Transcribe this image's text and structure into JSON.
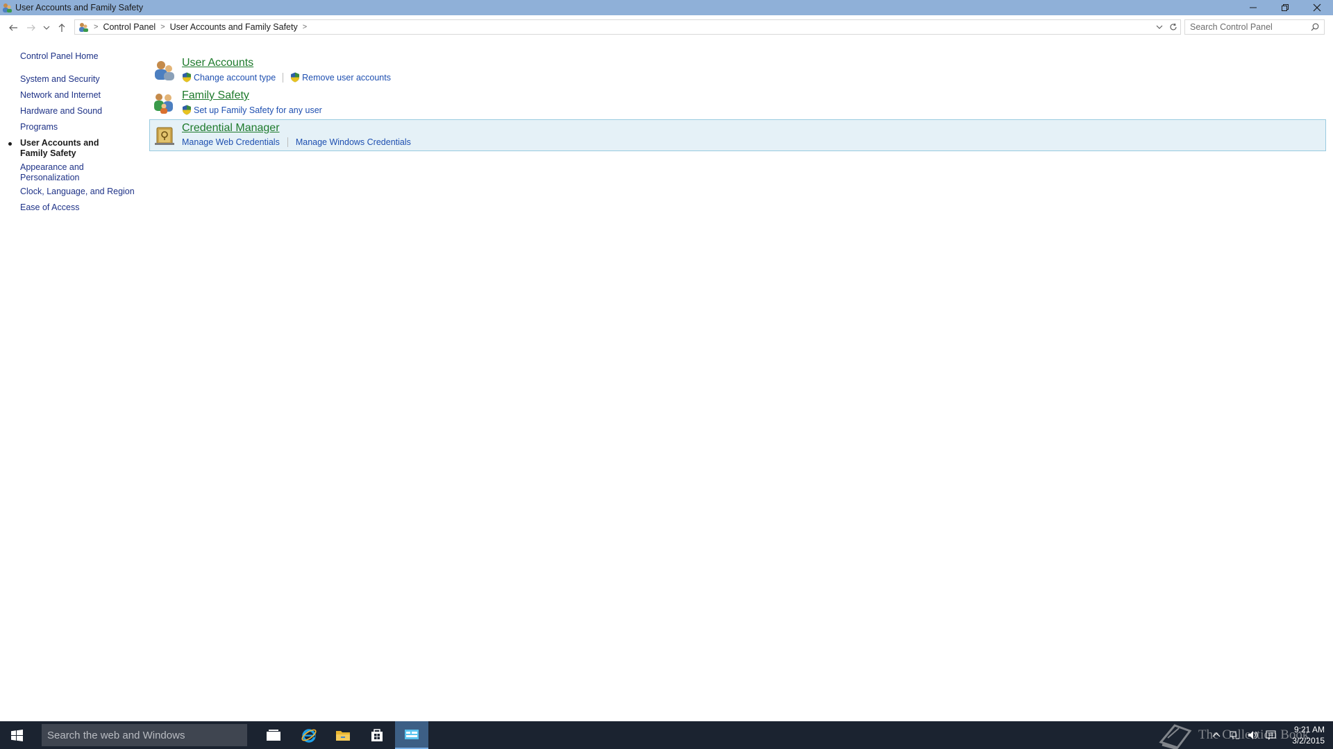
{
  "window": {
    "title": "User Accounts and Family Safety"
  },
  "address": {
    "crumbs": [
      "Control Panel",
      "User Accounts and Family Safety"
    ],
    "search_placeholder": "Search Control Panel"
  },
  "sidebar": {
    "home": "Control Panel Home",
    "items": [
      {
        "label": "System and Security"
      },
      {
        "label": "Network and Internet"
      },
      {
        "label": "Hardware and Sound"
      },
      {
        "label": "Programs"
      },
      {
        "label": "User Accounts and Family Safety",
        "current": true
      },
      {
        "label": "Appearance and Personalization"
      },
      {
        "label": "Clock, Language, and Region"
      },
      {
        "label": "Ease of Access"
      }
    ]
  },
  "categories": [
    {
      "title": "User Accounts",
      "links": [
        "Change account type",
        "Remove user accounts"
      ]
    },
    {
      "title": "Family Safety",
      "links": [
        "Set up Family Safety for any user"
      ]
    },
    {
      "title": "Credential Manager",
      "links": [
        "Manage Web Credentials",
        "Manage Windows Credentials"
      ]
    }
  ],
  "taskbar": {
    "search_placeholder": "Search the web and Windows",
    "watermark": "The Collection Book",
    "time": "9:21 AM",
    "date": "3/2/2015"
  },
  "colors": {
    "title_bar": "#8fb0d8",
    "category_title": "#1e7a2c",
    "link": "#1e4fb0",
    "highlight_bg": "#e5f1f7",
    "highlight_border": "#99cbe0",
    "taskbar": "#1b2330"
  }
}
